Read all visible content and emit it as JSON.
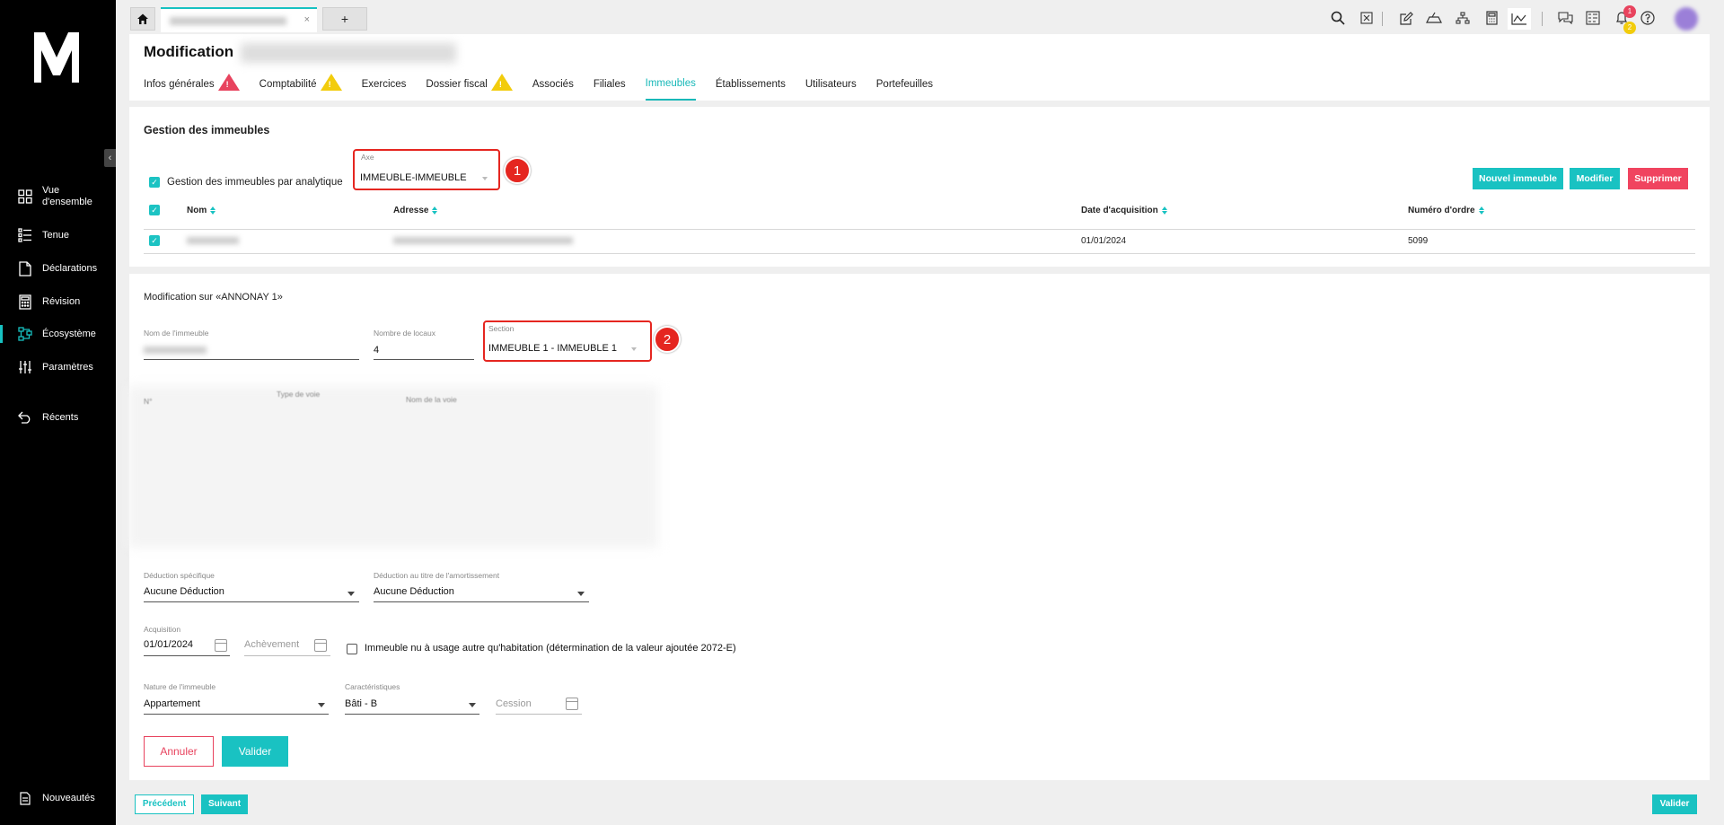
{
  "sidebar": {
    "items": [
      {
        "label": "Vue\nd'ensemble",
        "icon": "grid-icon"
      },
      {
        "label": "Tenue",
        "icon": "list-icon"
      },
      {
        "label": "Déclarations",
        "icon": "document-icon"
      },
      {
        "label": "Révision",
        "icon": "calculator-icon"
      },
      {
        "label": "Écosystème",
        "icon": "ecosystem-icon"
      },
      {
        "label": "Paramètres",
        "icon": "sliders-icon"
      },
      {
        "label": "Récents",
        "icon": "undo-icon"
      }
    ],
    "bottom_label": "Nouveautés",
    "collapse_glyph": "‹"
  },
  "topbar": {
    "plus_label": "+",
    "tab_close": "×",
    "badges": {
      "red": "1",
      "yellow": "2"
    }
  },
  "header": {
    "title": "Modification",
    "tabs": [
      {
        "label": "Infos générales",
        "warn": "red"
      },
      {
        "label": "Comptabilité",
        "warn": "yellow"
      },
      {
        "label": "Exercices",
        "warn": ""
      },
      {
        "label": "Dossier fiscal",
        "warn": "yellow"
      },
      {
        "label": "Associés",
        "warn": ""
      },
      {
        "label": "Filiales",
        "warn": ""
      },
      {
        "label": "Immeubles",
        "warn": "",
        "active": true
      },
      {
        "label": "Établissements",
        "warn": ""
      },
      {
        "label": "Utilisateurs",
        "warn": ""
      },
      {
        "label": "Portefeuilles",
        "warn": ""
      }
    ],
    "warn_glyph": "!"
  },
  "gestion": {
    "title": "Gestion des immeubles",
    "checkbox_label": "Gestion des immeubles par analytique",
    "axe_label": "Axe",
    "axe_value": "IMMEUBLE-IMMEUBLE",
    "step1": "1",
    "buttons": {
      "new": "Nouvel immeuble",
      "edit": "Modifier",
      "delete": "Supprimer"
    },
    "columns": [
      "Nom",
      "Adresse",
      "Date d'acquisition",
      "Numéro d'ordre"
    ],
    "rows": [
      {
        "date": "01/01/2024",
        "numero": "5099"
      }
    ]
  },
  "modif": {
    "title": "Modification sur «ANNONAY 1»",
    "nom_label": "Nom de l'immeuble",
    "locaux_label": "Nombre de locaux",
    "locaux_value": "4",
    "section_label": "Section",
    "section_value": "IMMEUBLE 1 - IMMEUBLE 1",
    "step2": "2",
    "blur_labels": {
      "num": "N°",
      "type_voie": "Type de voie",
      "nom_voie": "Nom de la voie"
    },
    "deduction_label": "Déduction spécifique",
    "deduction_value": "Aucune Déduction",
    "amort_label": "Déduction au titre de l'amortissement",
    "amort_value": "Aucune Déduction",
    "acquisition_label": "Acquisition",
    "acquisition_value": "01/01/2024",
    "achevement_placeholder": "Achèvement",
    "usage_label": "Immeuble nu à usage autre qu'habitation (détermination de la valeur ajoutée 2072-E)",
    "nature_label": "Nature de l'immeuble",
    "nature_value": "Appartement",
    "carac_label": "Caractéristiques",
    "carac_value": "Bâti - B",
    "cession_placeholder": "Cession",
    "cancel": "Annuler",
    "validate": "Valider"
  },
  "footer": {
    "prev": "Précédent",
    "next": "Suivant",
    "validate": "Valider"
  },
  "colors": {
    "accent": "#19c2c2",
    "danger": "#e8435e",
    "warning": "#f2cc0c",
    "highlight": "#e52620"
  }
}
